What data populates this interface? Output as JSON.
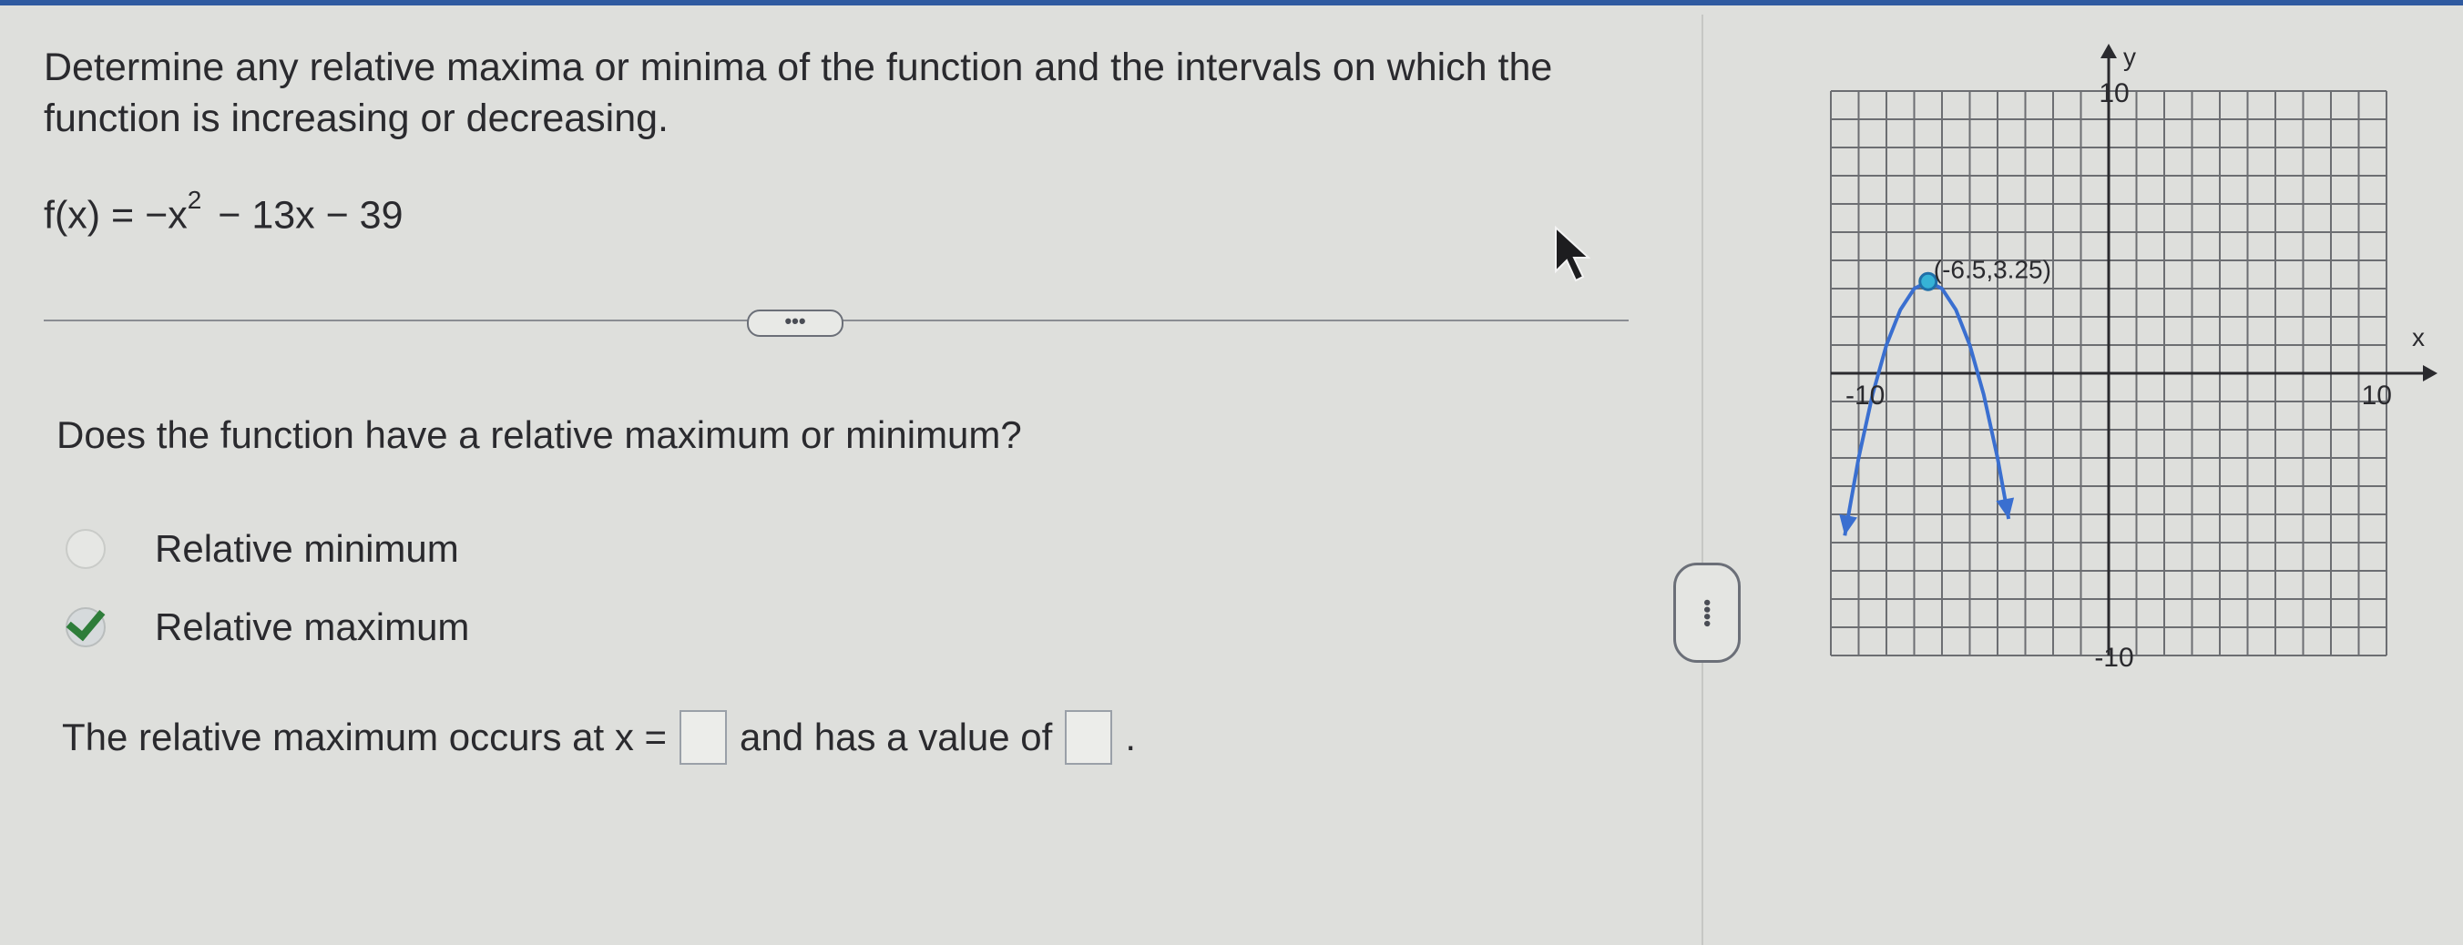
{
  "question": {
    "prompt": "Determine any relative maxima or minima of the function and the intervals on which the function is increasing or decreasing.",
    "function_lhs": "f(x) = −x",
    "function_exp": "2",
    "function_rest": "− 13x − 39",
    "more_label": "•••"
  },
  "subquestion": "Does the function have a relative maximum or minimum?",
  "options": [
    {
      "label": "Relative minimum",
      "selected": false
    },
    {
      "label": "Relative maximum",
      "selected": true
    }
  ],
  "answer": {
    "text_before": "The relative maximum occurs at x =",
    "text_middle": "and has a value of",
    "text_after": ".",
    "x_value": "",
    "y_value": ""
  },
  "panel_handle_label": "••••",
  "graph": {
    "x_axis_label": "x",
    "y_axis_label": "y",
    "x_min_label": "-10",
    "x_max_label": "10",
    "y_max_label": "10",
    "y_min_label": "-10",
    "vertex_label": "(-6.5,3.25)"
  },
  "chart_data": {
    "type": "line",
    "function": "f(x) = -x^2 - 13x - 39",
    "x": [
      -9.5,
      -9,
      -8.5,
      -8,
      -7.5,
      -7,
      -6.5,
      -6,
      -5.5,
      -5,
      -4.5,
      -4,
      -3.6
    ],
    "y": [
      -5.75,
      -3,
      -0.75,
      1,
      2.25,
      3,
      3.25,
      3,
      2.25,
      1,
      -0.75,
      -3,
      -5.16
    ],
    "vertex": {
      "x": -6.5,
      "y": 3.25
    },
    "xlim": [
      -10,
      10
    ],
    "ylim": [
      -10,
      10
    ],
    "xlabel": "x",
    "ylabel": "y",
    "grid": true,
    "series": [
      {
        "color": "#3a6fd0"
      }
    ]
  },
  "colors": {
    "curve": "#3a6fd0",
    "vertex_point": "#36b3d6",
    "check": "#2e7d3a"
  }
}
